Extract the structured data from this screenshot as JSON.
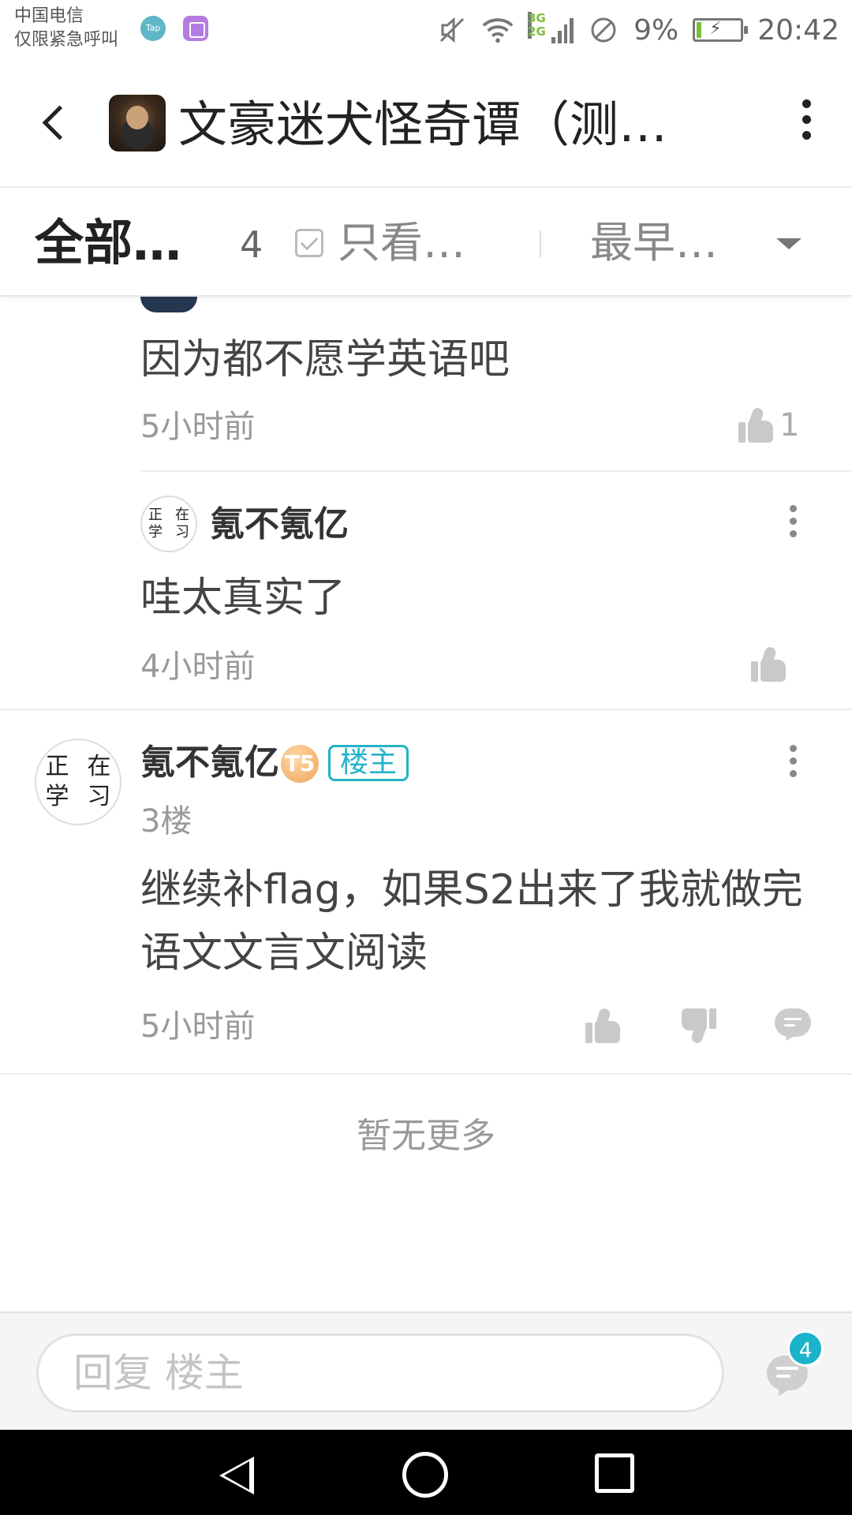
{
  "status_bar": {
    "carrier_line1": "中国电信",
    "carrier_line2": "仅限紧急呼叫",
    "tap_label": "Tap",
    "network": "3G\n2G",
    "battery": "9%",
    "time": "20:42"
  },
  "header": {
    "title": "文豪迷犬怪奇谭（测…"
  },
  "filter": {
    "all_label": "全部…",
    "count": "4",
    "only_label": "只看…",
    "sort_label": "最早…"
  },
  "comments": [
    {
      "text": "因为都不愿学英语吧",
      "time": "5小时前",
      "likes": "1"
    },
    {
      "avatar_chars": [
        "正",
        "在",
        "学",
        "习"
      ],
      "username": "氪不氪亿",
      "text": "哇太真实了",
      "time": "4小时前",
      "likes": ""
    }
  ],
  "main_post": {
    "avatar_chars": [
      "正",
      "在",
      "学",
      "习"
    ],
    "username": "氪不氪亿",
    "level": "T5",
    "owner_tag": "楼主",
    "floor": "3楼",
    "text_line1": "继续补flag，如果S2出来了我就做完",
    "text_line2": "语文文言文阅读",
    "time": "5小时前"
  },
  "no_more": "暂无更多",
  "reply": {
    "placeholder": "回复  楼主",
    "badge": "4"
  },
  "colors": {
    "accent": "#22b3c9",
    "badge": "#1ab3c9",
    "level_badge": "#f0a45a"
  }
}
